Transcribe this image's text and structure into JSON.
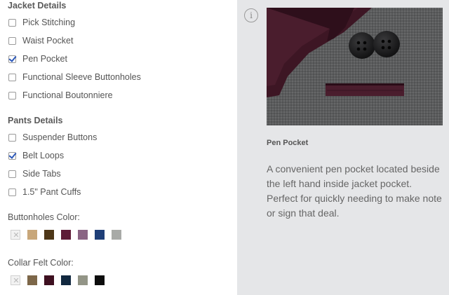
{
  "jacket": {
    "title": "Jacket Details",
    "options": [
      {
        "label": "Pick Stitching",
        "checked": false
      },
      {
        "label": "Waist Pocket",
        "checked": false
      },
      {
        "label": "Pen Pocket",
        "checked": true
      },
      {
        "label": "Functional Sleeve Buttonholes",
        "checked": false
      },
      {
        "label": "Functional Boutonniere",
        "checked": false
      }
    ]
  },
  "pants": {
    "title": "Pants Details",
    "options": [
      {
        "label": "Suspender Buttons",
        "checked": false
      },
      {
        "label": "Belt Loops",
        "checked": true
      },
      {
        "label": "Side Tabs",
        "checked": false
      },
      {
        "label": "1.5\" Pant Cuffs",
        "checked": false
      }
    ]
  },
  "buttonholes_color": {
    "label": "Buttonholes Color:",
    "swatches": [
      "none",
      "#c8a77a",
      "#4e3718",
      "#5e1a36",
      "#8a6584",
      "#1f3f78",
      "#a8aaa7"
    ]
  },
  "collar_felt_color": {
    "label": "Collar Felt Color:",
    "swatches": [
      "none",
      "#7d6749",
      "#3e1020",
      "#11283f",
      "#939587",
      "#0d0d0d"
    ]
  },
  "detail": {
    "info_icon": "info-icon",
    "title": "Pen Pocket",
    "description": "A convenient pen pocket located beside the left hand inside jacket pocket. Perfect for quickly needing to make note or sign that deal."
  },
  "colors": {
    "panel_background": "#e5e6e8",
    "check_color": "#2a57b9"
  }
}
